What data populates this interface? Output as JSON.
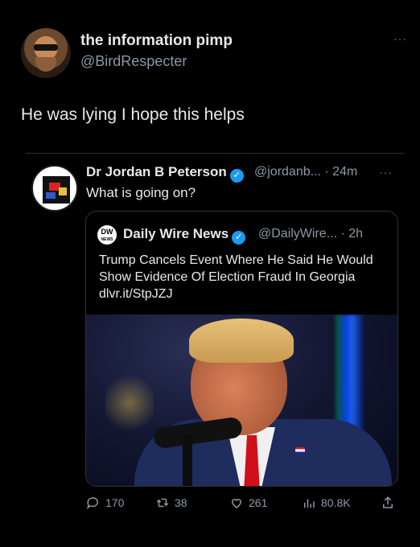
{
  "post": {
    "author_name": "the information pimp",
    "author_handle": "@BirdRespecter",
    "more": "···",
    "text": "He was lying I hope this helps"
  },
  "quote": {
    "author_name": "Dr Jordan B Peterson",
    "verified": "✓",
    "handle_time": "@jordanb... · 24m",
    "more": "···",
    "text": "What is going on?",
    "card": {
      "logo_text": "DW",
      "logo_sub": "NEWS",
      "source_name": "Daily Wire News",
      "verified": "✓",
      "handle_time": "@DailyWire... · 2h",
      "text": "Trump Cancels Event Where He Said He Would Show Evidence Of Election Fraud In Georgia dlvr.it/StpJZJ"
    }
  },
  "actions": {
    "reply_count": "170",
    "retweet_count": "38",
    "like_count": "261",
    "views_count": "80.8K"
  },
  "colors": {
    "background": "#000000",
    "text_primary": "#e7e9ea",
    "text_secondary": "#8b98a5",
    "accent": "#1d9bf0"
  },
  "icons": [
    "reply-icon",
    "retweet-icon",
    "like-icon",
    "views-icon",
    "share-icon",
    "verified-icon",
    "more-icon"
  ]
}
